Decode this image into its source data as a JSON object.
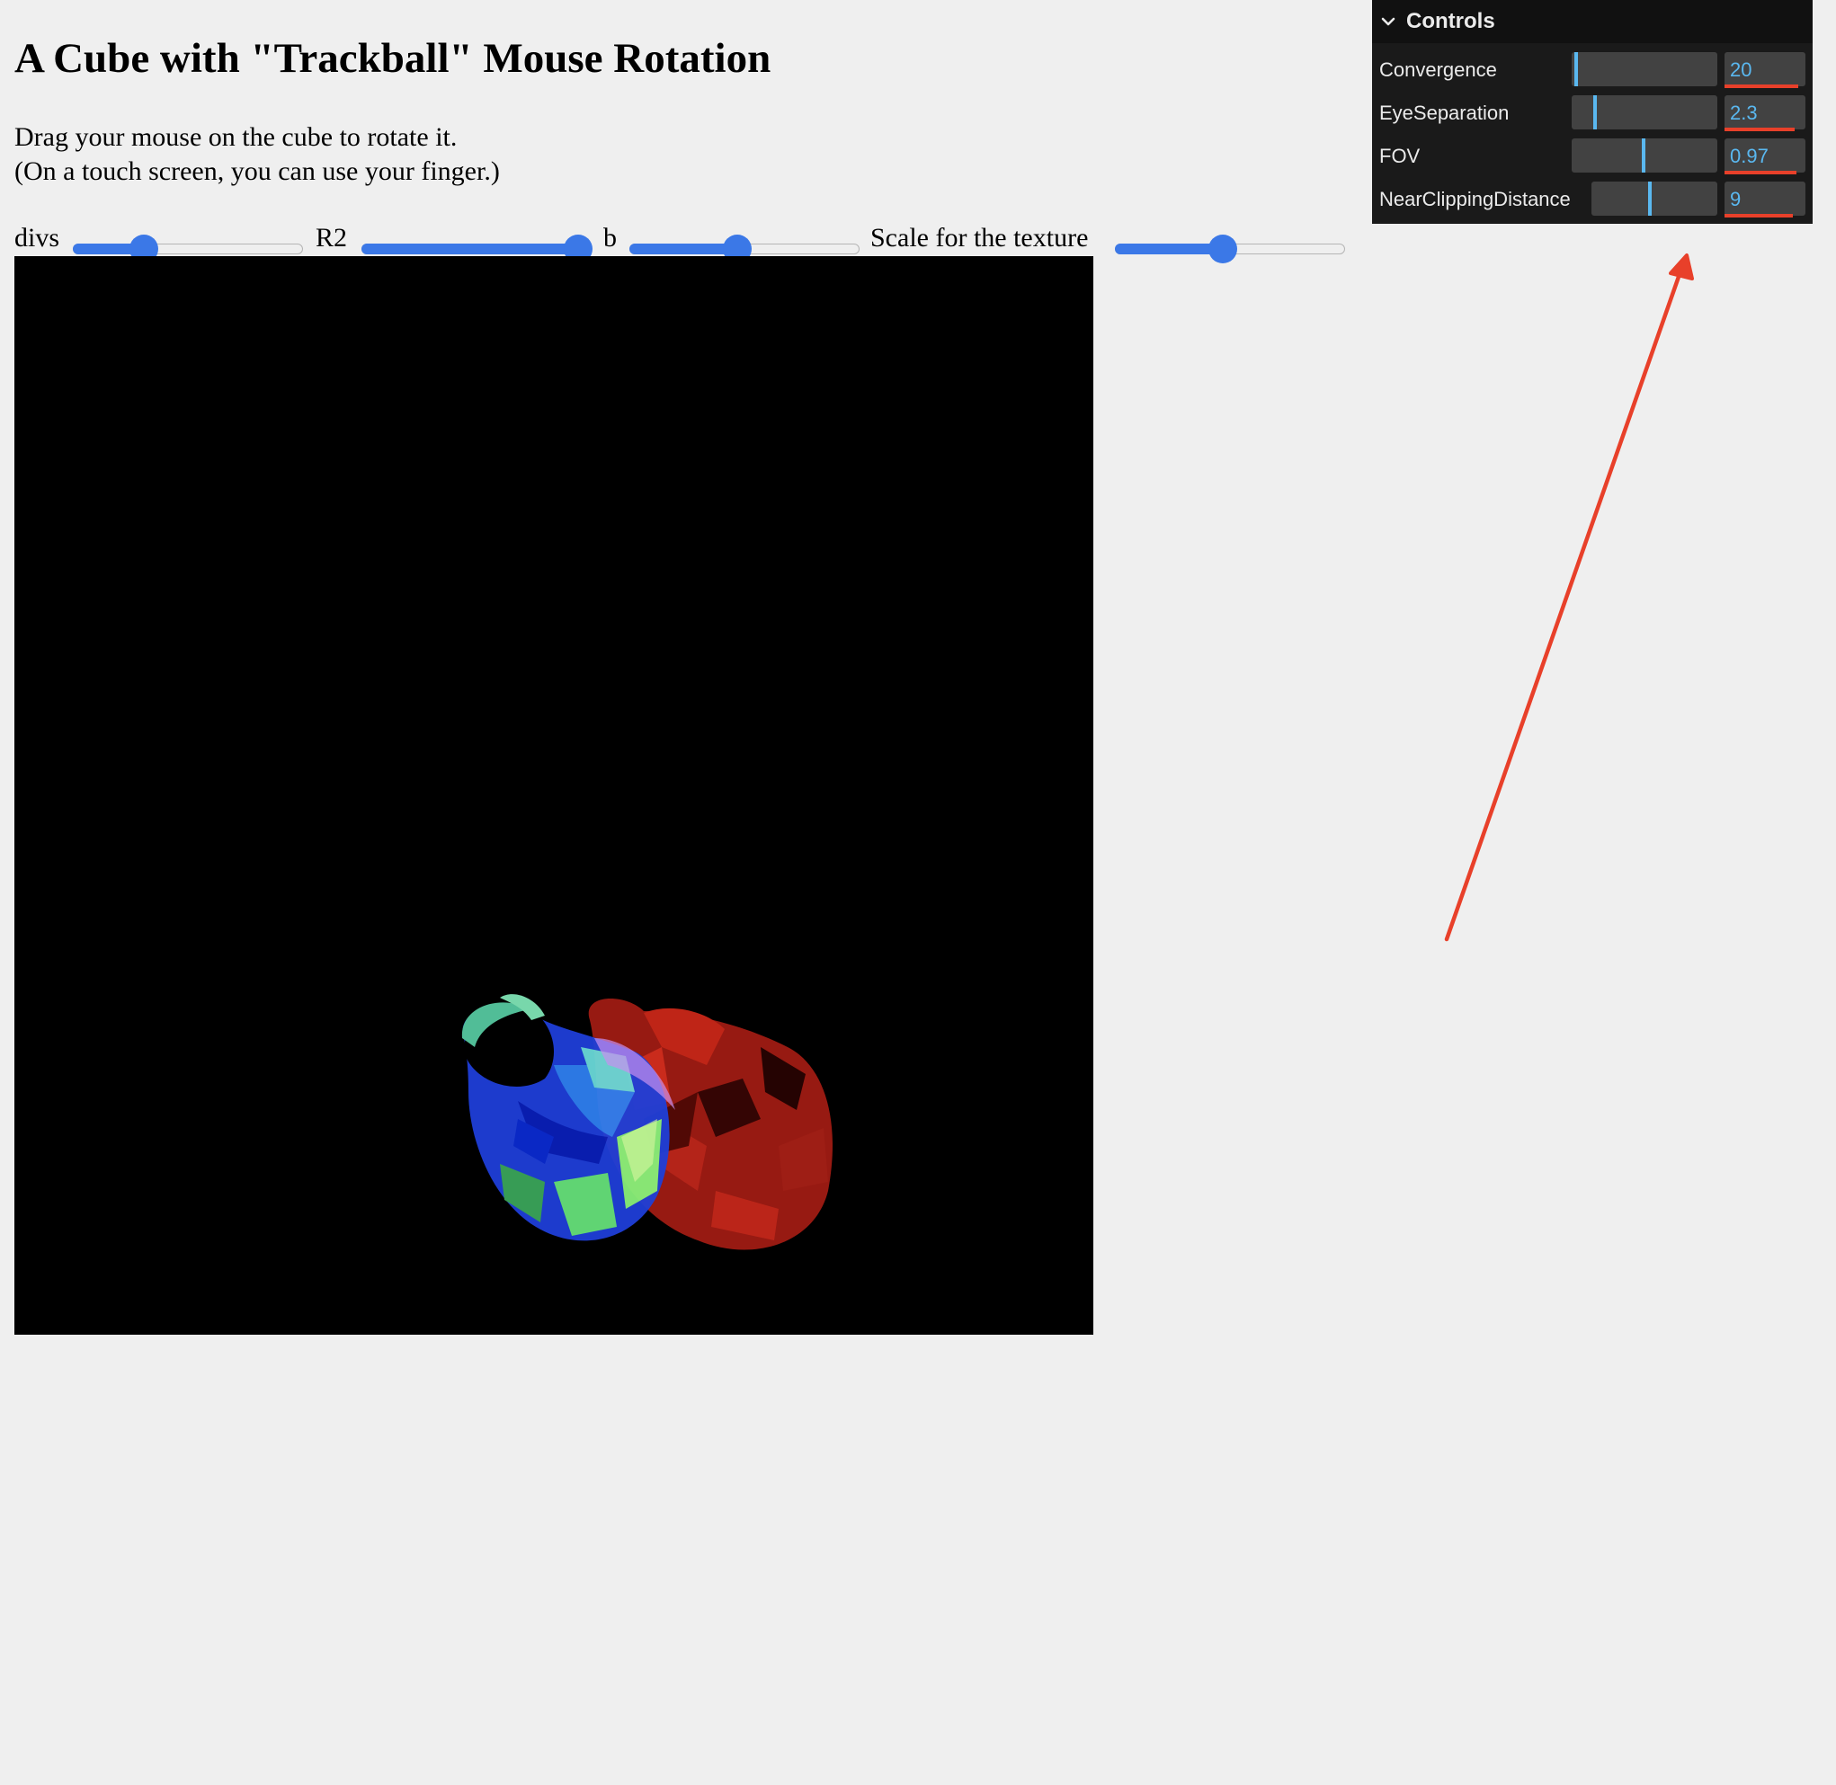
{
  "page": {
    "title": "A Cube with \"Trackball\" Mouse Rotation",
    "instruction_line1": "Drag your mouse on the cube to rotate it.",
    "instruction_line2": "(On a touch screen, you can use your finger.)"
  },
  "sliders": [
    {
      "label": "divs",
      "fraction": 0.31
    },
    {
      "label": "R2",
      "fraction": 0.94
    },
    {
      "label": "b",
      "fraction": 0.47
    },
    {
      "label": "Scale for the texture",
      "fraction": 0.47
    }
  ],
  "controls": {
    "title": "Controls",
    "items": [
      {
        "label": "Convergence",
        "value": "20",
        "fraction": 0.02
      },
      {
        "label": "EyeSeparation",
        "value": "2.3",
        "fraction": 0.15
      },
      {
        "label": "FOV",
        "value": "0.97",
        "fraction": 0.48
      },
      {
        "label": "NearClippingDistance",
        "value": "9",
        "fraction": 0.45
      }
    ]
  },
  "colors": {
    "slider_accent": "#3b78e7",
    "panel_bg": "#1a1a1a",
    "value_text": "#5ab8f0",
    "annotation_arrow": "#e8402a",
    "canvas_bg": "#000000"
  },
  "icons": {
    "panel_toggle": "chevron-down-icon"
  }
}
